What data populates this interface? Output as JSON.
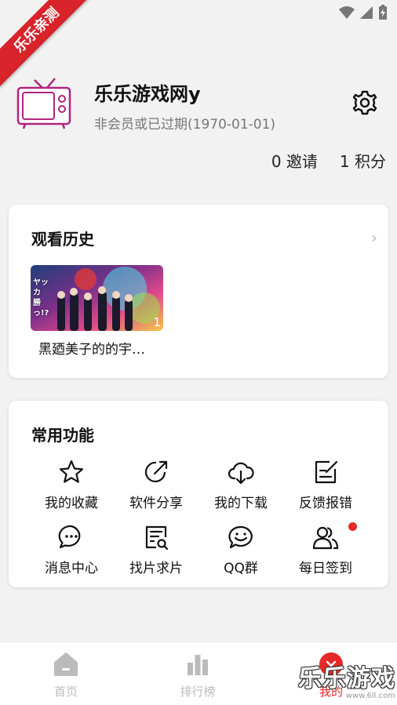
{
  "ribbon_text": "乐乐亲测",
  "profile": {
    "username": "乐乐游戏网y",
    "membership": "非会员或已过期(1970-01-01)"
  },
  "stats": {
    "invite": "0 邀请",
    "points": "1 积分"
  },
  "history": {
    "title": "观看历史",
    "more_icon": "chevron-right-icon",
    "items": [
      {
        "caption": "黑廼美子的的宇…",
        "badge": "1",
        "thumb_text": "ヤッカ 勝っ!?"
      }
    ]
  },
  "functions": {
    "title": "常用功能",
    "items": [
      {
        "label": "我的收藏",
        "icon": "star-icon"
      },
      {
        "label": "软件分享",
        "icon": "share-icon"
      },
      {
        "label": "我的下载",
        "icon": "cloud-download-icon"
      },
      {
        "label": "反馈报错",
        "icon": "feedback-icon"
      },
      {
        "label": "消息中心",
        "icon": "chat-bubble-icon"
      },
      {
        "label": "找片求片",
        "icon": "search-document-icon"
      },
      {
        "label": "QQ群",
        "icon": "qq-chat-icon"
      },
      {
        "label": "每日签到",
        "icon": "users-icon",
        "has_dot": true
      }
    ]
  },
  "tabs": [
    {
      "label": "首页",
      "icon": "home-icon"
    },
    {
      "label": "排行榜",
      "icon": "bar-chart-icon"
    },
    {
      "label": "我的",
      "icon": "profile-icon"
    }
  ],
  "watermark": {
    "main": "乐乐游戏",
    "sub": "www.6ll.com"
  },
  "colors": {
    "accent": "#e52a2a",
    "ribbon": "#d8232a",
    "tv_icon": "#b0247e"
  }
}
